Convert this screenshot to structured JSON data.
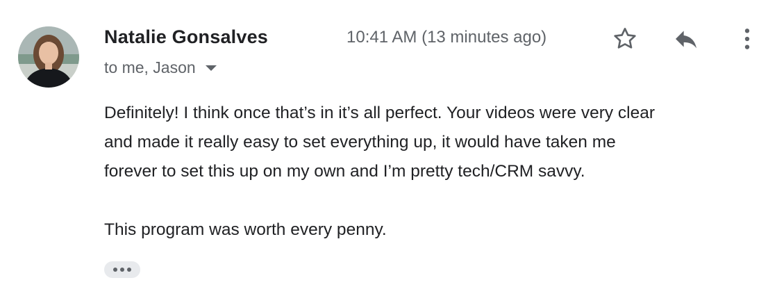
{
  "email": {
    "sender_name": "Natalie Gonsalves",
    "recipients_label": "to me, Jason",
    "timestamp": "10:41 AM (13 minutes ago)",
    "body": {
      "paragraph_1_line_1": "Definitely! I think once that’s in it’s all perfect. Your videos were very clear",
      "paragraph_1_line_2": "and made it really easy to set everything up, it would have taken me",
      "paragraph_1_line_3": "forever to set this up on my own and I’m pretty tech/CRM savvy.",
      "paragraph_2": "This program was worth every penny."
    }
  },
  "icons": {
    "avatar": "avatar-photo",
    "recipients_toggle": "caret-down-icon",
    "star": "star-outline-icon",
    "reply": "reply-arrow-icon",
    "more": "vertical-dots-icon",
    "show_trimmed": "ellipsis-icon"
  },
  "colors": {
    "text_primary": "#202124",
    "text_secondary": "#5f6368",
    "trimmed_pill_bg": "#e8eaed"
  }
}
